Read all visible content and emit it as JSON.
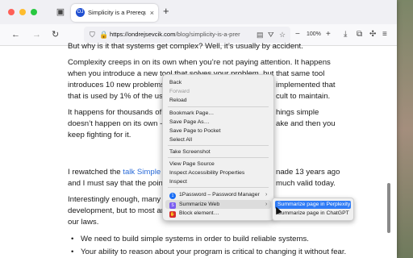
{
  "browser": {
    "tab": {
      "title": "Simplicity is a Prerequisite for R",
      "favicon": "OJ"
    },
    "new_tab_label": "+",
    "url": {
      "domain": "https://ondrejsevcik.com",
      "path": "/blog/simplicity-is-a-prerequisi"
    },
    "zoom": "100%"
  },
  "article": {
    "p0": "But why is it that systems get complex? Well, it’s usually by accident.",
    "p1_lines": [
      "Complexity creeps in on its own when you’re not paying attention. It happens",
      "when you introduce a new tool that solves your problem, but that same tool",
      "introduces 10 new problems.",
      "that is used by 1% of the users, bu"
    ],
    "p1_right": [
      "implemented that",
      "cult to maintain."
    ],
    "p2_lines": [
      "It happens for thousands of re",
      "doesn’t happen on its own -",
      "keep fighting for it."
    ],
    "p2_mid": "it",
    "p2_right": [
      "hings simple",
      "ake and then you"
    ],
    "p3_start": "I rewatched the",
    "p3_link": "talk Simple M",
    "p3_right": "nade 13 years ago",
    "p3_line2": "and I must say that the points",
    "p3_line2_right": "much valid today.",
    "p4_line1": "Interestingly enough, many o",
    "p4_line2": "development, but to most are",
    "p4_line3": "our laws.",
    "bullets": [
      "We need to build simple systems in order to build reliable systems.",
      "Your ability to reason about your program is critical to changing it without fear."
    ]
  },
  "context_menu": {
    "items": [
      {
        "label": "Back"
      },
      {
        "label": "Forward",
        "disabled": true
      },
      {
        "label": "Reload"
      },
      {
        "label": "Bookmark Page…"
      },
      {
        "label": "Save Page As…"
      },
      {
        "label": "Save Page to Pocket"
      },
      {
        "label": "Select All"
      },
      {
        "label": "Take Screenshot"
      },
      {
        "label": "View Page Source"
      },
      {
        "label": "Inspect Accessibility Properties"
      },
      {
        "label": "Inspect"
      },
      {
        "label": "1Password – Password Manager",
        "icon": "1password-icon"
      },
      {
        "label": "Summarize Web",
        "icon": "summarize-web-icon"
      },
      {
        "label": "Block element…",
        "icon": "adblock-icon"
      }
    ]
  },
  "submenu": {
    "items": [
      {
        "label": "Summarize page in Perplexity",
        "active": true
      },
      {
        "label": "Summarize page in ChatGPT"
      }
    ]
  },
  "colors": {
    "accent": "#2f7bf5",
    "link": "#2a6bd8"
  }
}
